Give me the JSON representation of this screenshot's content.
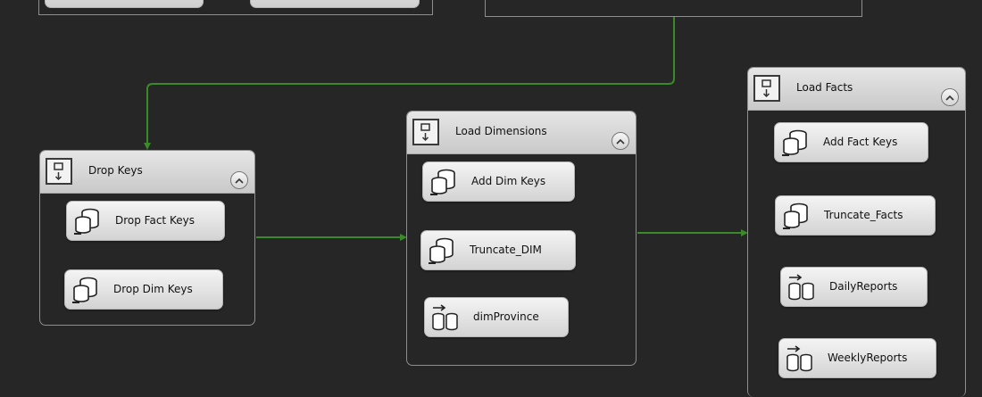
{
  "containers": {
    "drop_keys": {
      "title": "Drop Keys",
      "tasks": [
        {
          "label": "Drop Fact Keys",
          "icon": "sql-task-icon"
        },
        {
          "label": "Drop Dim Keys",
          "icon": "sql-task-icon"
        }
      ]
    },
    "load_dimensions": {
      "title": "Load Dimensions",
      "tasks": [
        {
          "label": "Add Dim Keys",
          "icon": "sql-task-icon"
        },
        {
          "label": "Truncate_DIM",
          "icon": "sql-task-icon"
        },
        {
          "label": "dimProvince",
          "icon": "data-flow-task-icon"
        }
      ]
    },
    "load_facts": {
      "title": "Load Facts",
      "tasks": [
        {
          "label": "Add Fact Keys",
          "icon": "sql-task-icon"
        },
        {
          "label": "Truncate_Facts",
          "icon": "sql-task-icon"
        },
        {
          "label": "DailyReports",
          "icon": "data-flow-task-icon"
        },
        {
          "label": "WeeklyReports",
          "icon": "data-flow-task-icon"
        }
      ]
    }
  },
  "colors": {
    "canvas": "#262626",
    "connector": "#3a8a2a",
    "header": "#d8d8d8",
    "border": "#8e8e8e"
  }
}
